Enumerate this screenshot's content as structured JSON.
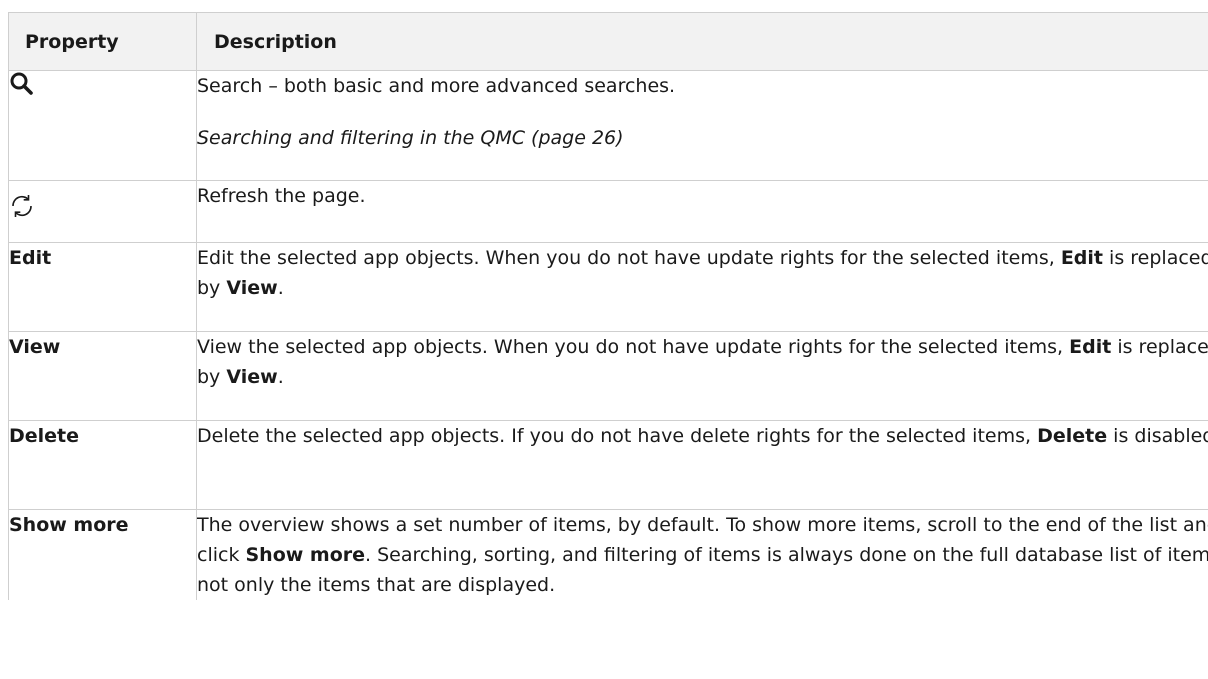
{
  "table": {
    "headers": {
      "property": "Property",
      "description": "Description"
    },
    "rows": [
      {
        "property_icon": "search-icon",
        "description": "Search – both basic and more advanced searches.",
        "link": "Searching and filtering in the QMC (page 26)"
      },
      {
        "property_icon": "refresh-icon",
        "description": "Refresh the page."
      },
      {
        "property": "Edit",
        "description_pre": "Edit the selected app objects. When you do not have update rights for the selected items, ",
        "bold1": "Edit",
        "mid": " is replaced by ",
        "bold2": "View",
        "post": "."
      },
      {
        "property": "View",
        "description_pre": "View the selected app objects. When you do not have update rights for the selected items, ",
        "bold1": "Edit",
        "mid": " is replaced by ",
        "bold2": "View",
        "post": "."
      },
      {
        "property": "Delete",
        "description_pre": "Delete the selected app objects. If you do not have delete rights for the selected items, ",
        "bold1": "Delete",
        "post": " is disabled."
      },
      {
        "property": "Show more",
        "description_pre": "The overview shows a set number of items, by default. To show more items, scroll to the end of the list and click ",
        "bold1": "Show more",
        "post": ". Searching, sorting, and filtering of items is always done on the full database list of items, not only the items that are displayed."
      }
    ]
  }
}
